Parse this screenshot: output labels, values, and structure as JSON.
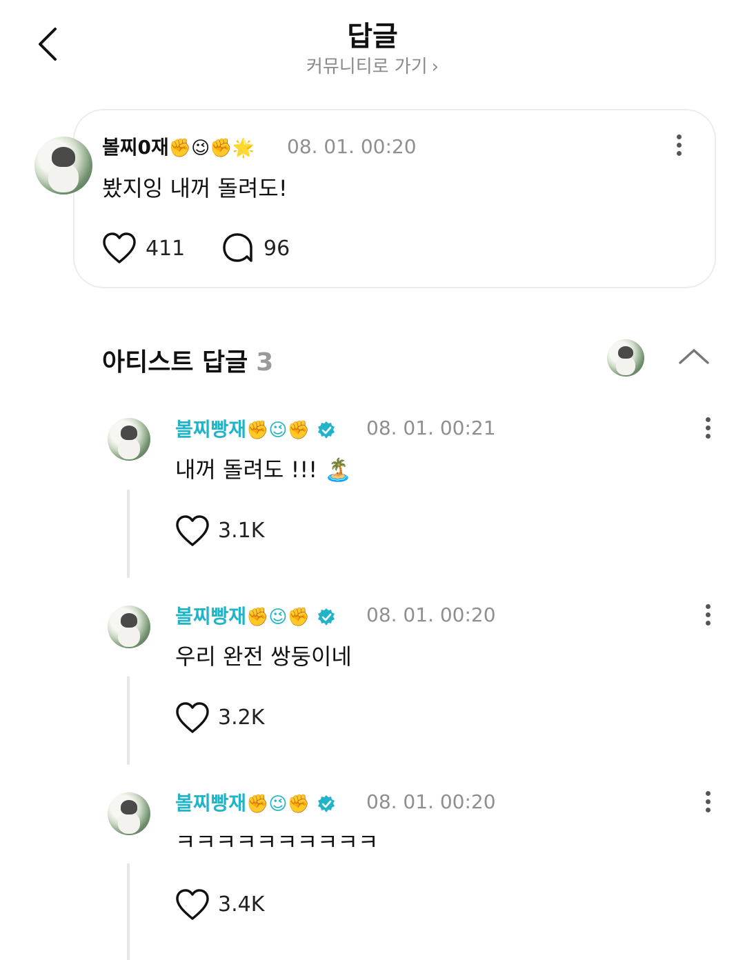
{
  "header": {
    "title": "답글",
    "subtitle": "커뮤니티로 가기",
    "subtitle_chevron": "›"
  },
  "post": {
    "author": "볼찌0재",
    "emojis": "✊😉✊🌟",
    "time": "08. 01. 00:20",
    "text": "봤지잉 내꺼 돌려도!",
    "likes": "411",
    "comments": "96"
  },
  "section": {
    "title": "아티스트 답글",
    "count": "3"
  },
  "replies": [
    {
      "author": "볼찌빵재",
      "emojis": "✊😉✊",
      "time": "08. 01. 00:21",
      "text": "내꺼 돌려도 !!! 🏝️",
      "likes": "3.1K"
    },
    {
      "author": "볼찌빵재",
      "emojis": "✊😉✊",
      "time": "08. 01. 00:20",
      "text": "우리 완전 쌍둥이네",
      "likes": "3.2K"
    },
    {
      "author": "볼찌빵재",
      "emojis": "✊😉✊",
      "time": "08. 01. 00:20",
      "text": "ㅋㅋㅋㅋㅋㅋㅋㅋㅋㅋ",
      "likes": "3.4K"
    }
  ],
  "colors": {
    "artist_name": "#21b4c8",
    "verified_badge": "#21b4c8",
    "meta": "#8f8f8f"
  },
  "icons": [
    "back-arrow-icon",
    "chevron-right-icon",
    "more-vertical-icon",
    "heart-icon",
    "comment-bubble-icon",
    "chevron-up-icon",
    "verified-badge-icon"
  ]
}
